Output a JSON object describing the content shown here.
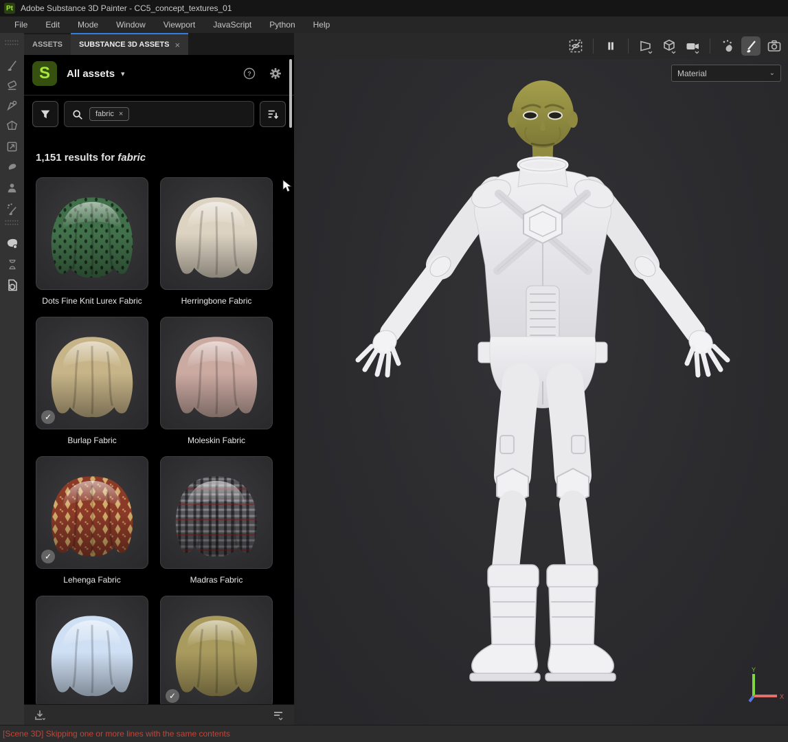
{
  "title_bar": {
    "app_badge": "Pt",
    "title": "Adobe Substance 3D Painter - CC5_concept_textures_01"
  },
  "menu_bar": {
    "items": [
      "File",
      "Edit",
      "Mode",
      "Window",
      "Viewport",
      "JavaScript",
      "Python",
      "Help"
    ]
  },
  "left_toolbar": {
    "tools": [
      "paint-brush",
      "eraser",
      "projection",
      "polygon-fill",
      "smudge",
      "clone-stamp",
      "material-picker",
      "particles",
      "mesh-material",
      "hourglass",
      "resources-updater"
    ]
  },
  "assets_panel": {
    "tabs": [
      {
        "label": "ASSETS",
        "active": false
      },
      {
        "label": "SUBSTANCE 3D ASSETS",
        "active": true,
        "close": "×"
      }
    ],
    "header": {
      "scope_label": "All assets",
      "chevron": "▾"
    },
    "search": {
      "chip": "fabric",
      "chip_close": "×"
    },
    "results": {
      "count": "1,151",
      "middle": "results for",
      "term": "fabric"
    },
    "cards": [
      {
        "label": "Dots Fine Knit Lurex Fabric",
        "color": "#41714a",
        "selected": false,
        "pattern": "dots"
      },
      {
        "label": "Herringbone Fabric",
        "color": "#ddd3c2",
        "selected": false,
        "pattern": "plain"
      },
      {
        "label": "Burlap Fabric",
        "color": "#c7b488",
        "selected": true,
        "pattern": "plain"
      },
      {
        "label": "Moleskin Fabric",
        "color": "#cbaaa2",
        "selected": false,
        "pattern": "plain"
      },
      {
        "label": "Lehenga Fabric",
        "color": "#8c3a28",
        "selected": true,
        "pattern": "ornate"
      },
      {
        "label": "Madras Fabric",
        "color": "#55555a",
        "selected": false,
        "pattern": "plaid"
      },
      {
        "label": "",
        "color": "#cfe0f4",
        "selected": false,
        "pattern": "plain"
      },
      {
        "label": "",
        "color": "#a99b5e",
        "selected": true,
        "pattern": "plain"
      }
    ],
    "checkmark": "✓"
  },
  "viewport": {
    "toolbar_icons": [
      "symmetry-visibility",
      "pause",
      "camera-frustum",
      "geometry-cube",
      "video-camera",
      "physics-particles",
      "paint-brush",
      "screenshot-camera"
    ],
    "shading_mode": {
      "value": "Material",
      "chevron": "⌄"
    },
    "axis_gizmo": {
      "x_label": "X",
      "y_label": "Y"
    }
  },
  "status_bar": {
    "message": "[Scene 3D] Skipping one or more lines with the same contents"
  },
  "colors": {
    "accent_blue": "#2e7fe4",
    "substance_green": "#a8ea3c",
    "status_red": "#c0463a",
    "axis_x": "#e0706a",
    "axis_y": "#7fd63f",
    "axis_z": "#5a78e8"
  }
}
